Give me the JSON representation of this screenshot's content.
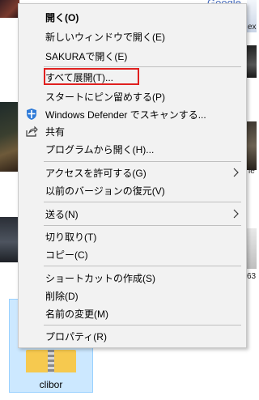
{
  "menu": {
    "items": [
      {
        "label": "開く(O)"
      },
      {
        "label": "新しいウィンドウで開く(E)"
      },
      {
        "label": "SAKURAで開く(E)"
      },
      {
        "label": "すべて展開(T)..."
      },
      {
        "label": "スタートにピン留めする(P)"
      },
      {
        "label": "Windows Defender でスキャンする..."
      },
      {
        "label": "共有"
      },
      {
        "label": "プログラムから開く(H)..."
      },
      {
        "label": "アクセスを許可する(G)"
      },
      {
        "label": "以前のバージョンの復元(V)"
      },
      {
        "label": "送る(N)"
      },
      {
        "label": "切り取り(T)"
      },
      {
        "label": "コピー(C)"
      },
      {
        "label": "ショートカットの作成(S)"
      },
      {
        "label": "削除(D)"
      },
      {
        "label": "名前の変更(M)"
      },
      {
        "label": "プロパティ(R)"
      }
    ],
    "icons": {
      "defender": "shield-icon",
      "share": "share-icon",
      "submenu": "chevron-right-icon"
    },
    "highlight_color": "#e0201f"
  },
  "background": {
    "folder_label": "clibor",
    "google_peek": "Google",
    "right_text_1": "ex",
    "right_text_2": "le",
    "right_text_3": "63"
  }
}
